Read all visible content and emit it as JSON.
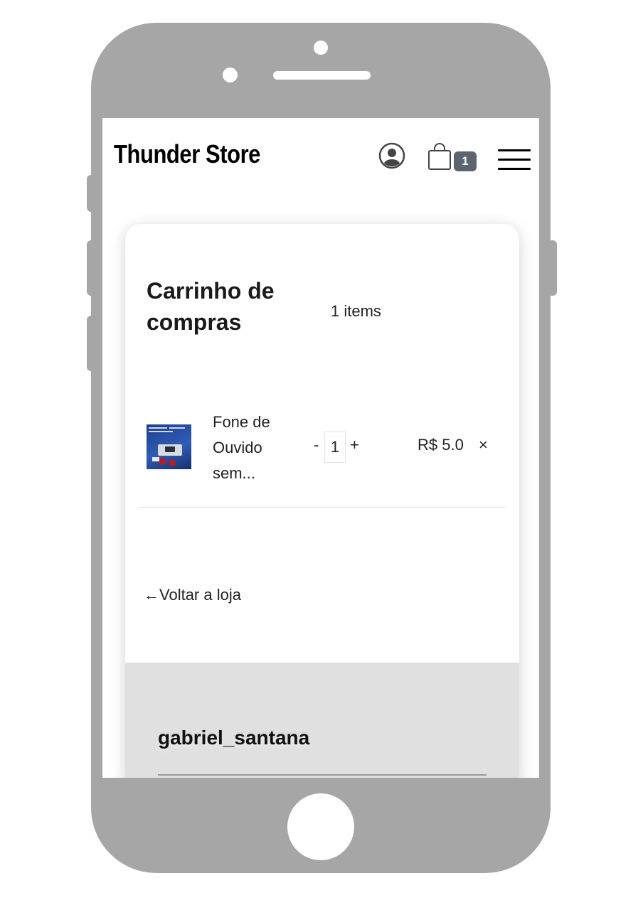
{
  "header": {
    "logo": "Thunder Store",
    "cart_badge": "1"
  },
  "cart": {
    "title": "Carrinho de compras",
    "item_count": "1 items",
    "items": [
      {
        "name": "Fone de Ouvido sem...",
        "quantity_minus": "-",
        "quantity": "1",
        "quantity_plus": "+",
        "price": "R$ 5.0",
        "remove": "×"
      }
    ],
    "back_link": "←Voltar a loja"
  },
  "summary": {
    "username": "gabriel_santana"
  },
  "icons": {
    "user": "user-circle-icon",
    "bag": "shopping-bag-icon",
    "menu": "hamburger-menu-icon"
  },
  "colors": {
    "device": "#a6a6a6",
    "badge": "#5c6470",
    "summary_bg": "#e0e0e0"
  }
}
